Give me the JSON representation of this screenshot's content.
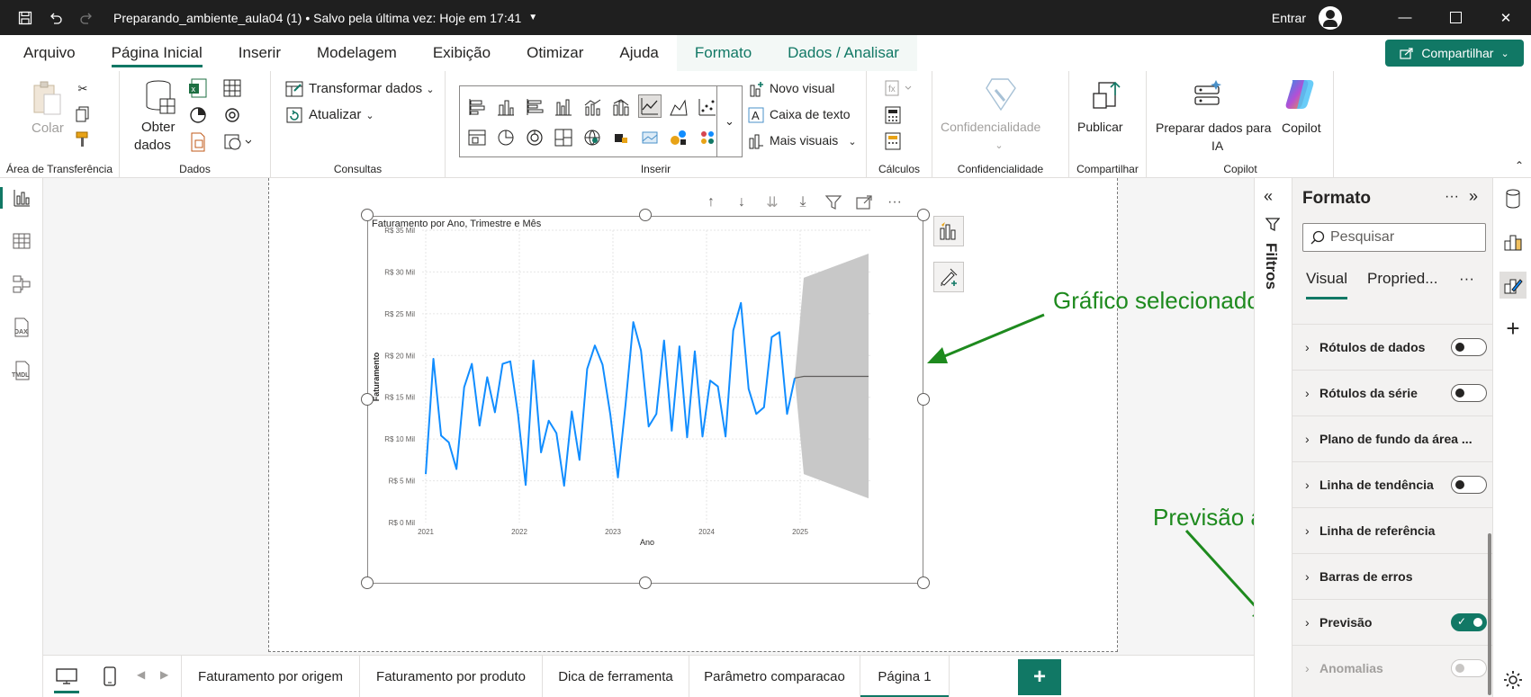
{
  "titlebar": {
    "doc_title": "Preparando_ambiente_aula04 (1)",
    "saved": "• Salvo pela última vez: Hoje em 17:41",
    "signin": "Entrar"
  },
  "ribbon_tabs": [
    "Arquivo",
    "Página Inicial",
    "Inserir",
    "Modelagem",
    "Exibição",
    "Otimizar",
    "Ajuda",
    "Formato",
    "Dados / Analisar"
  ],
  "active_tab": "Página Inicial",
  "share_label": "Compartilhar",
  "ribbon": {
    "clipboard": {
      "paste": "Colar",
      "group": "Área de Transferência"
    },
    "data": {
      "get_data_1": "Obter",
      "get_data_2": "dados",
      "group": "Dados"
    },
    "queries": {
      "transform": "Transformar dados",
      "refresh": "Atualizar",
      "group": "Consultas"
    },
    "insert": {
      "new_visual": "Novo visual",
      "text_box": "Caixa de texto",
      "more_visuals": "Mais visuais",
      "group": "Inserir"
    },
    "calc": {
      "group": "Cálculos"
    },
    "sensitivity": {
      "label": "Confidencialidade",
      "group": "Confidencialidade"
    },
    "share": {
      "publish": "Publicar",
      "group": "Compartilhar"
    },
    "copilot": {
      "prepare_1": "Preparar dados para",
      "prepare_2": "IA",
      "copilot": "Copilot",
      "group": "Copilot"
    }
  },
  "chart_data": {
    "type": "line",
    "title": "Faturamento por Ano, Trimestre e Mês",
    "xlabel": "Ano",
    "ylabel": "Faturamento",
    "x_ticks": [
      "2021",
      "2022",
      "2023",
      "2024",
      "2025"
    ],
    "y_ticks": [
      "R$ 0 Mil",
      "R$ 5 Mil",
      "R$ 10 Mil",
      "R$ 15 Mil",
      "R$ 20 Mil",
      "R$ 25 Mil",
      "R$ 30 Mil",
      "R$ 35 Mil"
    ],
    "ylim": [
      0,
      35
    ],
    "y_unit": "R$ Mil",
    "grid": true,
    "color": "#118dff",
    "series": [
      {
        "values": [
          5.8,
          19.6,
          10.4,
          9.6,
          6.4,
          16.2,
          19.0,
          11.6,
          17.4,
          13.2,
          19.0,
          19.3,
          13.0,
          4.5,
          19.4,
          8.4,
          12.2,
          10.7,
          4.4,
          13.3,
          7.5,
          18.4,
          21.2,
          18.9,
          13.0,
          5.4,
          14.2,
          24.0,
          20.6,
          11.5,
          13.0,
          21.8,
          11.0,
          21.1,
          10.2,
          20.5,
          10.3,
          17.0,
          16.3,
          10.3,
          23.0,
          26.3,
          16.0,
          13.0,
          13.8,
          22.2,
          22.8,
          13.0,
          17.3
        ]
      }
    ],
    "forecast": {
      "value": 17.5,
      "upper": [
        29.3,
        32.2
      ],
      "lower": [
        5.8,
        2.9
      ],
      "fill": "#c8c8c8"
    }
  },
  "annotations": {
    "selected": "Gráfico selecionado",
    "forecast_active": "Previsão ativa"
  },
  "filters_label": "Filtros",
  "format_pane": {
    "title": "Formato",
    "search_placeholder": "Pesquisar",
    "tabs": [
      "Visual",
      "Propried..."
    ],
    "rows": [
      {
        "label": "Rótulos de dados",
        "toggle": "off"
      },
      {
        "label": "Rótulos da série",
        "toggle": "off"
      },
      {
        "label": "Plano de fundo da área ...",
        "toggle": "none"
      },
      {
        "label": "Linha de tendência",
        "toggle": "off"
      },
      {
        "label": "Linha de referência",
        "toggle": "none"
      },
      {
        "label": "Barras de erros",
        "toggle": "none"
      },
      {
        "label": "Previsão",
        "toggle": "on"
      },
      {
        "label": "Anomalias",
        "toggle": "disabled"
      }
    ]
  },
  "page_tabs": [
    "Faturamento por origem",
    "Faturamento por produto",
    "Dica de ferramenta",
    "Parâmetro comparacao",
    "Página 1"
  ],
  "active_page": "Página 1",
  "colors": {
    "accent": "#117865",
    "line": "#118dff",
    "annotation": "#1e8a1e"
  }
}
